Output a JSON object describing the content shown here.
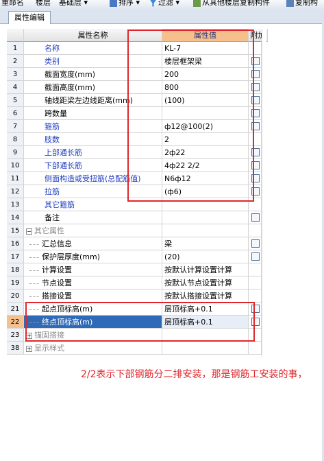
{
  "toolbar": {
    "items": [
      "重命名",
      "楼层",
      "基础层",
      "排序",
      "过滤",
      "从其他楼层复制构件",
      "复制构"
    ]
  },
  "tab": {
    "label": "属性编辑"
  },
  "grid": {
    "headers": {
      "name": "属性名称",
      "value": "属性值",
      "add": "附加"
    },
    "rows": [
      {
        "num": "1",
        "name": "名称",
        "value": "KL-7",
        "style": "blue",
        "check": false
      },
      {
        "num": "2",
        "name": "类别",
        "value": "楼层框架梁",
        "style": "blue",
        "check": true
      },
      {
        "num": "3",
        "name": "截面宽度(mm)",
        "value": "200",
        "style": "",
        "check": true
      },
      {
        "num": "4",
        "name": "截面高度(mm)",
        "value": "800",
        "style": "",
        "check": true
      },
      {
        "num": "5",
        "name": "轴线距梁左边线距离(mm)",
        "value": "(100)",
        "style": "",
        "check": true
      },
      {
        "num": "6",
        "name": "跨数量",
        "value": "",
        "style": "",
        "check": true
      },
      {
        "num": "7",
        "name": "箍筋",
        "value": "ф12@100(2)",
        "style": "blue",
        "check": true
      },
      {
        "num": "8",
        "name": "肢数",
        "value": "2",
        "style": "blue",
        "check": false
      },
      {
        "num": "9",
        "name": "上部通长筋",
        "value": "2ф22",
        "style": "blue",
        "check": true
      },
      {
        "num": "10",
        "name": "下部通长筋",
        "value": "4ф22 2/2",
        "style": "blue",
        "check": true
      },
      {
        "num": "11",
        "name": "侧面构造或受扭筋(总配筋值)",
        "value": "N6ф12",
        "style": "blue",
        "check": true
      },
      {
        "num": "12",
        "name": "拉筋",
        "value": "(ф6)",
        "style": "blue",
        "check": true
      },
      {
        "num": "13",
        "name": "其它箍筋",
        "value": "",
        "style": "blue",
        "check": false
      },
      {
        "num": "14",
        "name": "备注",
        "value": "",
        "style": "",
        "check": true
      },
      {
        "num": "15",
        "name": "其它属性",
        "value": "",
        "style": "group",
        "check": false
      },
      {
        "num": "16",
        "name": "汇总信息",
        "value": "梁",
        "style": "child",
        "check": true
      },
      {
        "num": "17",
        "name": "保护层厚度(mm)",
        "value": "(20)",
        "style": "child",
        "check": true
      },
      {
        "num": "18",
        "name": "计算设置",
        "value": "按默认计算设置计算",
        "style": "child",
        "check": false
      },
      {
        "num": "19",
        "name": "节点设置",
        "value": "按默认节点设置计算",
        "style": "child",
        "check": false
      },
      {
        "num": "20",
        "name": "搭接设置",
        "value": "按默认搭接设置计算",
        "style": "child",
        "check": false
      },
      {
        "num": "21",
        "name": "起点顶标高(m)",
        "value": "层顶标高+0.1",
        "style": "child",
        "check": true
      },
      {
        "num": "22",
        "name": "终点顶标高(m)",
        "value": "层顶标高+0.1",
        "style": "selected",
        "check": true
      },
      {
        "num": "23",
        "name": "锚固搭接",
        "value": "",
        "style": "collapsed",
        "check": false
      },
      {
        "num": "38",
        "name": "显示样式",
        "value": "",
        "style": "collapsed",
        "check": false
      }
    ]
  },
  "annotation": {
    "text": "2/2表示下部钢筋分二排安装，那是钢筋工安装的事，",
    "color": "#e0262b"
  }
}
